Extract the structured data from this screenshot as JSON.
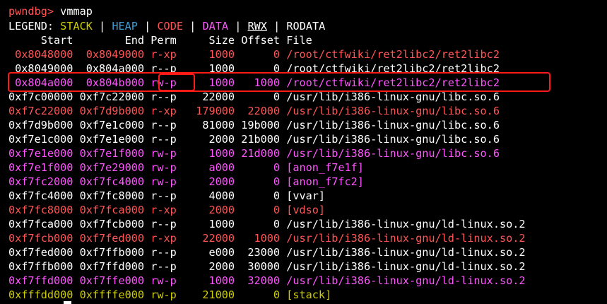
{
  "terminal": {
    "colors": {
      "background": "#000000",
      "text": "#ffffff",
      "red": "#ff5555",
      "yellow": "#cdcd00",
      "blue": "#3b9fd9",
      "magenta": "#ff55ff",
      "highlight_box": "#ff1a1a"
    },
    "prompt": "pwndbg>",
    "command": "vmmap",
    "legend": {
      "label": "LEGEND:",
      "stack": "STACK",
      "heap": "HEAP",
      "code": "CODE",
      "data": "DATA",
      "rwx": "RWX",
      "rodata": "RODATA",
      "sep": "|"
    },
    "header": {
      "start": "Start",
      "end": "End",
      "perm": "Perm",
      "size": "Size",
      "offset": "Offset",
      "file": "File"
    },
    "rows": [
      {
        "start": "0x8048000",
        "end": "0x8049000",
        "perm": "r-xp",
        "size": "1000",
        "offset": "0",
        "file": "/root/ctfwiki/ret2libc2/ret2libc2",
        "color": "red"
      },
      {
        "start": "0x8049000",
        "end": "0x804a000",
        "perm": "r--p",
        "size": "1000",
        "offset": "0",
        "file": "/root/ctfwiki/ret2libc2/ret2libc2",
        "color": "white"
      },
      {
        "start": "0x804a000",
        "end": "0x804b000",
        "perm": "rw-p",
        "size": "1000",
        "offset": "1000",
        "file": "/root/ctfwiki/ret2libc2/ret2libc2",
        "color": "magenta"
      },
      {
        "start": "0xf7c00000",
        "end": "0xf7c22000",
        "perm": "r--p",
        "size": "22000",
        "offset": "0",
        "file": "/usr/lib/i386-linux-gnu/libc.so.6",
        "color": "white"
      },
      {
        "start": "0xf7c22000",
        "end": "0xf7d9b000",
        "perm": "r-xp",
        "size": "179000",
        "offset": "22000",
        "file": "/usr/lib/i386-linux-gnu/libc.so.6",
        "color": "red"
      },
      {
        "start": "0xf7d9b000",
        "end": "0xf7e1c000",
        "perm": "r--p",
        "size": "81000",
        "offset": "19b000",
        "file": "/usr/lib/i386-linux-gnu/libc.so.6",
        "color": "white"
      },
      {
        "start": "0xf7e1c000",
        "end": "0xf7e1e000",
        "perm": "r--p",
        "size": "2000",
        "offset": "21b000",
        "file": "/usr/lib/i386-linux-gnu/libc.so.6",
        "color": "white"
      },
      {
        "start": "0xf7e1e000",
        "end": "0xf7e1f000",
        "perm": "rw-p",
        "size": "1000",
        "offset": "21d000",
        "file": "/usr/lib/i386-linux-gnu/libc.so.6",
        "color": "magenta"
      },
      {
        "start": "0xf7e1f000",
        "end": "0xf7e29000",
        "perm": "rw-p",
        "size": "a000",
        "offset": "0",
        "file": "[anon_f7e1f]",
        "color": "magenta"
      },
      {
        "start": "0xf7fc2000",
        "end": "0xf7fc4000",
        "perm": "rw-p",
        "size": "2000",
        "offset": "0",
        "file": "[anon_f7fc2]",
        "color": "magenta"
      },
      {
        "start": "0xf7fc4000",
        "end": "0xf7fc8000",
        "perm": "r--p",
        "size": "4000",
        "offset": "0",
        "file": "[vvar]",
        "color": "white"
      },
      {
        "start": "0xf7fc8000",
        "end": "0xf7fca000",
        "perm": "r-xp",
        "size": "2000",
        "offset": "0",
        "file": "[vdso]",
        "color": "red"
      },
      {
        "start": "0xf7fca000",
        "end": "0xf7fcb000",
        "perm": "r--p",
        "size": "1000",
        "offset": "0",
        "file": "/usr/lib/i386-linux-gnu/ld-linux.so.2",
        "color": "white"
      },
      {
        "start": "0xf7fcb000",
        "end": "0xf7fed000",
        "perm": "r-xp",
        "size": "22000",
        "offset": "1000",
        "file": "/usr/lib/i386-linux-gnu/ld-linux.so.2",
        "color": "red"
      },
      {
        "start": "0xf7fed000",
        "end": "0xf7ffb000",
        "perm": "r--p",
        "size": "e000",
        "offset": "23000",
        "file": "/usr/lib/i386-linux-gnu/ld-linux.so.2",
        "color": "white"
      },
      {
        "start": "0xf7ffb000",
        "end": "0xf7ffd000",
        "perm": "r--p",
        "size": "2000",
        "offset": "30000",
        "file": "/usr/lib/i386-linux-gnu/ld-linux.so.2",
        "color": "white"
      },
      {
        "start": "0xf7ffd000",
        "end": "0xf7ffe000",
        "perm": "rw-p",
        "size": "1000",
        "offset": "32000",
        "file": "/usr/lib/i386-linux-gnu/ld-linux.so.2",
        "color": "magenta"
      },
      {
        "start": "0xfffdd000",
        "end": "0xffffe000",
        "perm": "rw-p",
        "size": "21000",
        "offset": "0",
        "file": "[stack]",
        "color": "yellow"
      }
    ]
  }
}
